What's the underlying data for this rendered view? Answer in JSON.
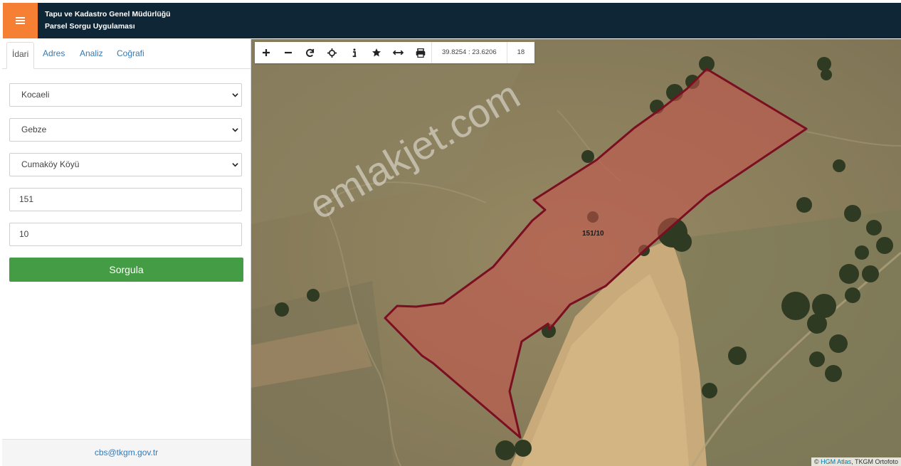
{
  "header": {
    "org_name": "Tapu ve Kadastro Genel Müdürlüğü",
    "app_name": "Parsel Sorgu Uygulaması",
    "menu_icon": "hamburger-menu-icon",
    "accent_color": "#f57f33",
    "bar_color": "#0f2636"
  },
  "sidebar": {
    "tabs": [
      {
        "label": "İdari",
        "active": true
      },
      {
        "label": "Adres",
        "active": false
      },
      {
        "label": "Analiz",
        "active": false
      },
      {
        "label": "Coğrafi",
        "active": false
      }
    ],
    "province": "Kocaeli",
    "district": "Gebze",
    "neighborhood": "Cumaköy Köyü",
    "block_no": "151",
    "parcel_no": "10",
    "query_button": "Sorgula",
    "footer_email": "cbs@tkgm.gov.tr"
  },
  "map": {
    "toolbar": {
      "tools": [
        "zoom-in-icon",
        "zoom-out-icon",
        "refresh-icon",
        "locate-icon",
        "info-icon",
        "favorite-star-icon",
        "measure-distance-icon",
        "print-icon"
      ],
      "coordinates": "39.8254 : 23.6206",
      "zoom_level": "18"
    },
    "parcel_label": "151/10",
    "watermark": "emlakjet.com",
    "attribution": {
      "prefix": "©",
      "link": "HGM Atlas",
      "suffix": ", TKGM Ortofoto"
    },
    "parcel_fill": "#c9524a",
    "parcel_stroke": "#7a0f22"
  }
}
